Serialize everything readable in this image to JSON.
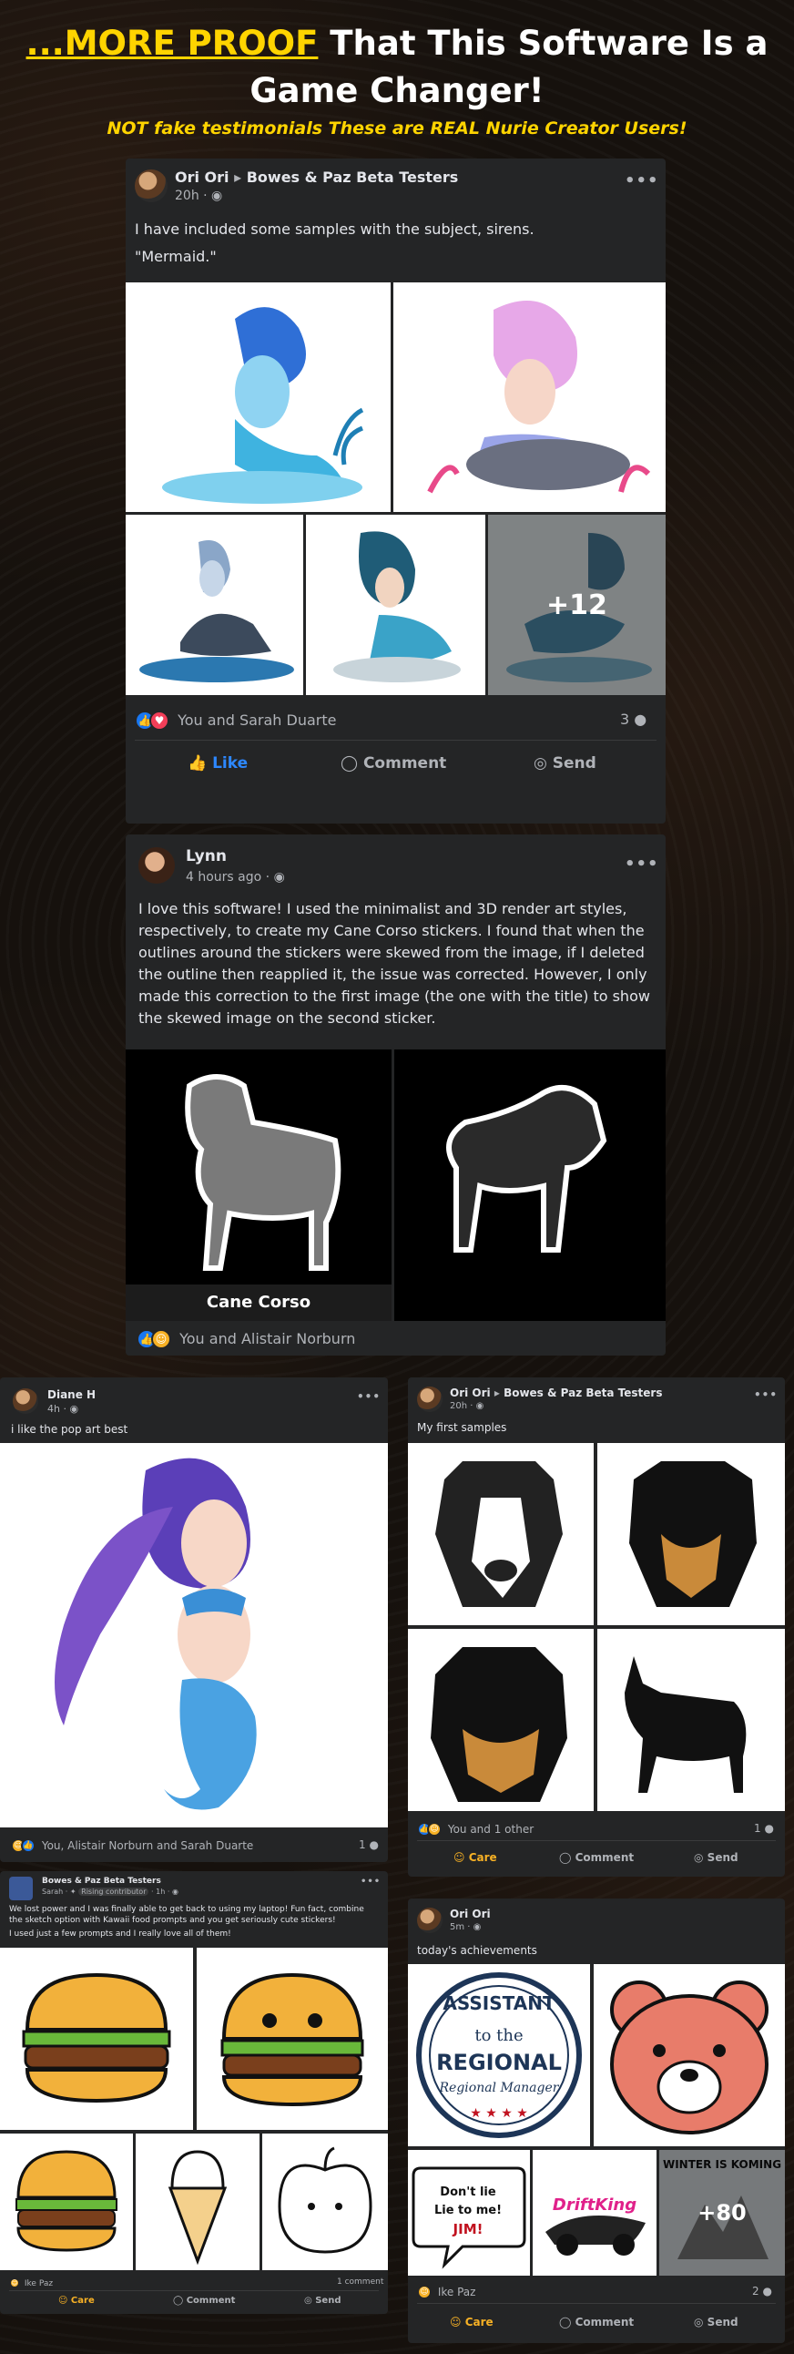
{
  "headline": {
    "highlight": "...MORE PROOF",
    "rest": " That This Software Is a Game Changer!"
  },
  "subheadline": "NOT fake testimonials These are REAL Nurie Creator Users!",
  "post1": {
    "author": "Ori Ori",
    "group": "Bowes & Paz Beta Testers",
    "time": "20h",
    "text1": "I have included some samples with the subject, sirens.",
    "text2": "\"Mermaid.\"",
    "more_count": "+12",
    "reactions": "You and Sarah Duarte",
    "comments": "3",
    "like": "Like",
    "comment": "Comment",
    "send": "Send"
  },
  "post2": {
    "author": "Lynn",
    "time": "4 hours ago",
    "text": "I love this software! I used the minimalist and 3D render art styles, respectively, to create my Cane Corso stickers. I found that when the outlines around the stickers were skewed from the image, if I deleted the outline then reapplied it, the issue was corrected. However, I only made this correction to the first image (the one with the title) to show the skewed image on the second sticker.",
    "caption": "Cane Corso",
    "reactions": "You and Alistair Norburn"
  },
  "post3": {
    "author": "Diane H",
    "time": "4h",
    "text": "i like the pop art best",
    "reactions": "You, Alistair Norburn and Sarah Duarte",
    "comments": "1"
  },
  "post4": {
    "author": "Ori Ori",
    "group": "Bowes & Paz Beta Testers",
    "time": "20h",
    "text": "My first samples",
    "reactions": "You and 1 other",
    "comments": "1",
    "care": "Care",
    "comment": "Comment",
    "send": "Send"
  },
  "post5": {
    "group": "Bowes & Paz Beta Testers",
    "author": "Sarah",
    "badge": "Rising contributor",
    "time": "1h",
    "text1": "We lost power and I was finally able to get back to using my laptop! Fun fact, combine the sketch option with Kawaii food prompts and you get seriously cute stickers!",
    "text2": "I used just a few prompts and I really love all of them!",
    "reactions": "Ike Paz",
    "comments": "1 comment",
    "care": "Care",
    "comment": "Comment",
    "send": "Send"
  },
  "post6": {
    "author": "Ori Ori",
    "time": "5m",
    "text": "today's achievements",
    "badge_line1": "ASSISTANT",
    "badge_line2": "to the",
    "badge_line3": "REGIONAL",
    "badge_line4": "Regional Manager",
    "bubble_text": "Don't lie Lie to me! JIM!",
    "drift_text": "DriftKing",
    "winter_text": "WINTER IS KOMING",
    "more_count": "+80",
    "reactions": "Ike Paz",
    "comments": "2",
    "care": "Care",
    "comment": "Comment",
    "send": "Send"
  },
  "icons": {
    "menu": "more-dots-icon",
    "globe": "globe-icon",
    "like": "thumbs-up-icon",
    "comment": "comment-bubble-icon",
    "send": "messenger-icon",
    "care": "care-emoji-icon"
  }
}
